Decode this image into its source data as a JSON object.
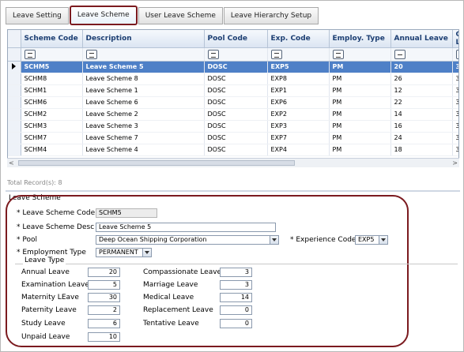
{
  "tabs": [
    {
      "label": "Leave Setting"
    },
    {
      "label": "Leave Scheme"
    },
    {
      "label": "User Leave Scheme"
    },
    {
      "label": "Leave Hierarchy Setup"
    }
  ],
  "grid": {
    "columns": [
      "Scheme Code",
      "Description",
      "Pool Code",
      "Exp. Code",
      "Employ. Type",
      "Annual Leave",
      "C L"
    ],
    "rows": [
      {
        "code": "SCHM5",
        "desc": "Leave Scheme 5",
        "pool": "DOSC",
        "exp": "EXP5",
        "type": "PM",
        "annual": "20",
        "c": "3"
      },
      {
        "code": "SCHM8",
        "desc": "Leave Scheme 8",
        "pool": "DOSC",
        "exp": "EXP8",
        "type": "PM",
        "annual": "26",
        "c": "3"
      },
      {
        "code": "SCHM1",
        "desc": "Leave Scheme 1",
        "pool": "DOSC",
        "exp": "EXP1",
        "type": "PM",
        "annual": "12",
        "c": "3"
      },
      {
        "code": "SCHM6",
        "desc": "Leave Scheme 6",
        "pool": "DOSC",
        "exp": "EXP6",
        "type": "PM",
        "annual": "22",
        "c": "3"
      },
      {
        "code": "SCHM2",
        "desc": "Leave Scheme 2",
        "pool": "DOSC",
        "exp": "EXP2",
        "type": "PM",
        "annual": "14",
        "c": "3"
      },
      {
        "code": "SCHM3",
        "desc": "Leave Scheme 3",
        "pool": "DOSC",
        "exp": "EXP3",
        "type": "PM",
        "annual": "16",
        "c": "3"
      },
      {
        "code": "SCHM7",
        "desc": "Leave Scheme 7",
        "pool": "DOSC",
        "exp": "EXP7",
        "type": "PM",
        "annual": "24",
        "c": "3"
      },
      {
        "code": "SCHM4",
        "desc": "Leave Scheme 4",
        "pool": "DOSC",
        "exp": "EXP4",
        "type": "PM",
        "annual": "18",
        "c": "3"
      }
    ],
    "total_label": "Total Record(s): 8",
    "scroll_left": "<",
    "scroll_right": ">"
  },
  "form": {
    "title": "Leave Scheme",
    "scheme_code_label": "* Leave Scheme Code",
    "scheme_code": "SCHM5",
    "scheme_desc_label": "* Leave Scheme Desc",
    "scheme_desc": "Leave Scheme 5",
    "pool_label": "* Pool",
    "pool": "Deep Ocean Shipping Corporation",
    "exp_label": "* Experience Code",
    "exp": "EXP5",
    "emp_label": "* Employment Type",
    "emp": "PERMANENT",
    "leave_type_title": "Leave Type",
    "leaves_left": [
      {
        "label": "Annual Leave",
        "value": "20"
      },
      {
        "label": "Examination Leave",
        "value": "5"
      },
      {
        "label": "Maternity LEave",
        "value": "30"
      },
      {
        "label": "Paternity Leave",
        "value": "2"
      },
      {
        "label": "Study Leave",
        "value": "6"
      },
      {
        "label": "Unpaid Leave",
        "value": "10"
      }
    ],
    "leaves_right": [
      {
        "label": "Compassionate Leave",
        "value": "3"
      },
      {
        "label": "Marriage Leave",
        "value": "3"
      },
      {
        "label": "Medical Leave",
        "value": "14"
      },
      {
        "label": "Replacement Leave",
        "value": "0"
      },
      {
        "label": "Tentative Leave",
        "value": "0"
      }
    ]
  },
  "colors": {
    "accent_oval": "#7b1a1f",
    "selected_row": "#4e80c7",
    "header_text": "#1d3f73"
  }
}
